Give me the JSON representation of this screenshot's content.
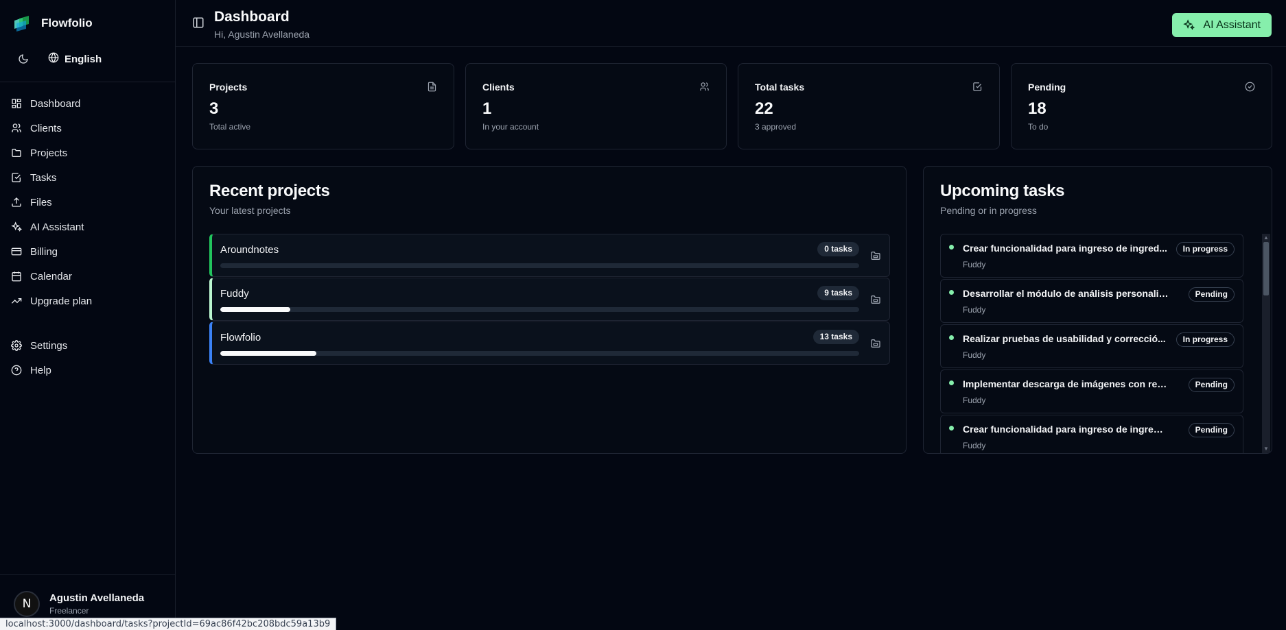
{
  "app": {
    "name": "Flowfolio"
  },
  "toolbar": {
    "language": "English"
  },
  "nav": {
    "items": [
      {
        "label": "Dashboard",
        "icon": "dashboard-icon"
      },
      {
        "label": "Clients",
        "icon": "users-icon"
      },
      {
        "label": "Projects",
        "icon": "folder-icon"
      },
      {
        "label": "Tasks",
        "icon": "check-square-icon"
      },
      {
        "label": "Files",
        "icon": "upload-icon"
      },
      {
        "label": "AI Assistant",
        "icon": "sparkles-icon"
      },
      {
        "label": "Billing",
        "icon": "credit-card-icon"
      },
      {
        "label": "Calendar",
        "icon": "calendar-icon"
      },
      {
        "label": "Upgrade plan",
        "icon": "trending-up-icon"
      }
    ],
    "secondary": [
      {
        "label": "Settings",
        "icon": "gear-icon"
      },
      {
        "label": "Help",
        "icon": "help-icon"
      }
    ]
  },
  "user": {
    "name": "Agustin Avellaneda",
    "role": "Freelancer",
    "initial": "N"
  },
  "statusbar": {
    "url": "localhost:3000/dashboard/tasks?projectId=69ac86f42bc208bdc59a13b9"
  },
  "header": {
    "title": "Dashboard",
    "subtitle": "Hi, Agustin Avellaneda",
    "ai_button": "AI Assistant"
  },
  "stats": [
    {
      "label": "Projects",
      "value": "3",
      "sub": "Total active",
      "icon": "file-icon"
    },
    {
      "label": "Clients",
      "value": "1",
      "sub": "In your account",
      "icon": "users-icon"
    },
    {
      "label": "Total tasks",
      "value": "22",
      "sub": "3 approved",
      "icon": "check-square-icon"
    },
    {
      "label": "Pending",
      "value": "18",
      "sub": "To do",
      "icon": "check-circle-icon"
    }
  ],
  "recent_projects": {
    "title": "Recent projects",
    "subtitle": "Your latest projects",
    "items": [
      {
        "name": "Aroundnotes",
        "tasks": "0 tasks",
        "progress": 0,
        "accent": "#22c55e"
      },
      {
        "name": "Fuddy",
        "tasks": "9 tasks",
        "progress": 0.11,
        "accent": "#bbf7d0"
      },
      {
        "name": "Flowfolio",
        "tasks": "13 tasks",
        "progress": 0.15,
        "accent": "#3b82f6"
      }
    ]
  },
  "upcoming_tasks": {
    "title": "Upcoming tasks",
    "subtitle": "Pending or in progress",
    "items": [
      {
        "title": "Crear funcionalidad para ingreso de ingred...",
        "project": "Fuddy",
        "status": "In progress"
      },
      {
        "title": "Desarrollar el módulo de análisis personalizado",
        "project": "Fuddy",
        "status": "Pending"
      },
      {
        "title": "Realizar pruebas de usabilidad y correcció...",
        "project": "Fuddy",
        "status": "In progress"
      },
      {
        "title": "Implementar descarga de imágenes con rece...",
        "project": "Fuddy",
        "status": "Pending"
      },
      {
        "title": "Crear funcionalidad para ingreso de ingredie...",
        "project": "Fuddy",
        "status": "Pending"
      }
    ]
  },
  "colors": {
    "accent": "#86efac",
    "background": "#030712",
    "card": "#050a14"
  }
}
